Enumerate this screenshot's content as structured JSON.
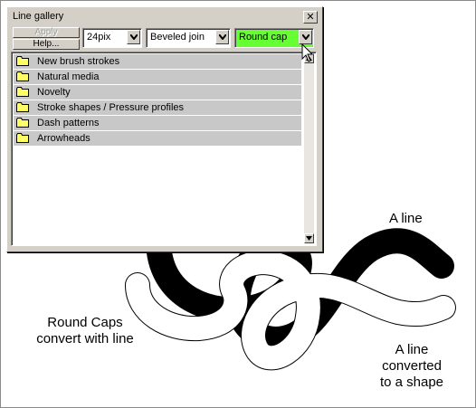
{
  "window": {
    "title": "Line gallery",
    "close_glyph": "✕"
  },
  "toolbar": {
    "apply_label": "Apply",
    "help_label": "Help...",
    "width_value": "24pix",
    "join_value": "Beveled join",
    "cap_value": "Round cap",
    "cap_highlight_color": "#66ff33"
  },
  "gallery_items": [
    {
      "label": "New brush strokes",
      "icon": "folder-icon"
    },
    {
      "label": "Natural media",
      "icon": "folder-icon"
    },
    {
      "label": "Novelty",
      "icon": "folder-icon"
    },
    {
      "label": "Stroke shapes / Pressure profiles",
      "icon": "folder-icon"
    },
    {
      "label": "Dash patterns",
      "icon": "folder-icon"
    },
    {
      "label": "Arrowheads",
      "icon": "folder-icon"
    }
  ],
  "captions": {
    "a_line": "A line",
    "round_caps_line1": "Round Caps",
    "round_caps_line2": "convert with line",
    "converted_line1": "A line",
    "converted_line2": "converted",
    "converted_line3": "to a shape"
  },
  "colors": {
    "panel": "#d4d0c8",
    "list_item": "#c8c8c8",
    "folder": "#ffff66",
    "stroke": "#000000"
  }
}
